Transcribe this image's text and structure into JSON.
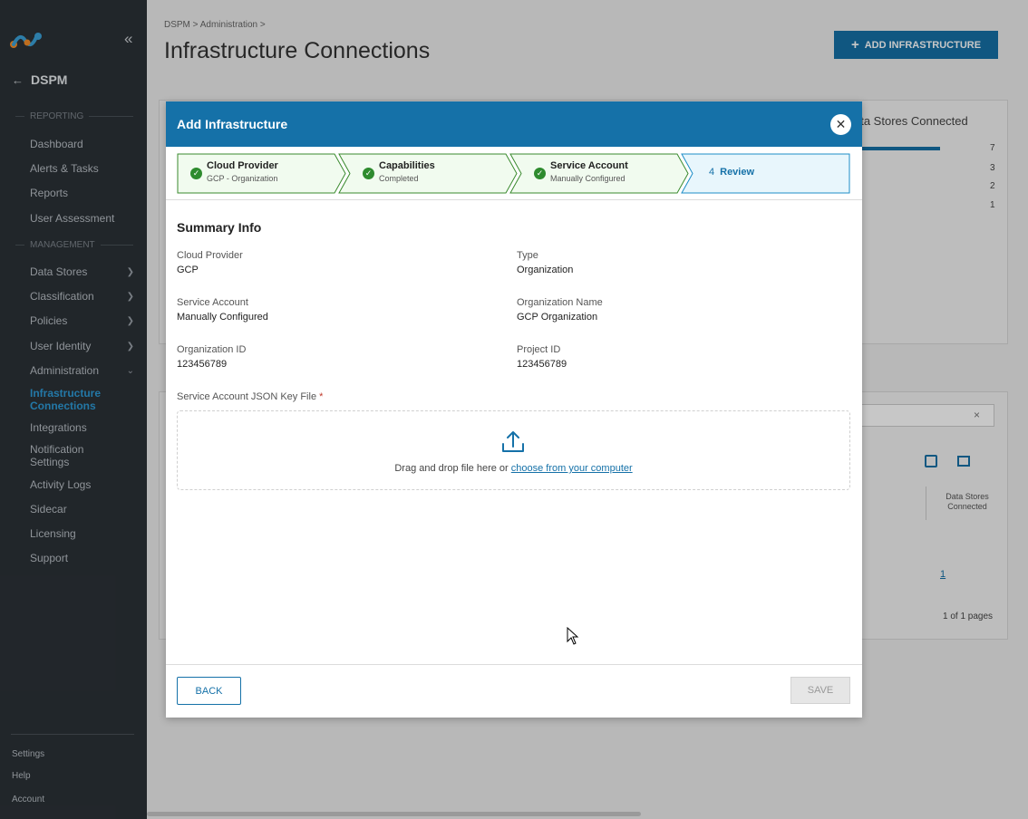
{
  "sidebar": {
    "app_name": "DSPM",
    "sections": {
      "reporting": "REPORTING",
      "management": "MANAGEMENT"
    },
    "reporting_items": [
      "Dashboard",
      "Alerts & Tasks",
      "Reports",
      "User Assessment"
    ],
    "management_items": [
      "Data Stores",
      "Classification",
      "Policies",
      "User Identity",
      "Administration"
    ],
    "admin_items": [
      "Infrastructure Connections",
      "Integrations",
      "Notification Settings",
      "Activity Logs",
      "Sidecar",
      "Licensing",
      "Support"
    ],
    "bottom_items": [
      "Settings",
      "Help",
      "Account"
    ],
    "colors": {
      "active": "#2d9ad6",
      "background": "#2b3137"
    }
  },
  "header": {
    "breadcrumb": "DSPM > Administration >",
    "title": "Infrastructure Connections",
    "add_button_label": "ADD INFRASTRUCTURE"
  },
  "background": {
    "card_title": "ata Stores Connected",
    "counts": [
      "7",
      "3",
      "2",
      "1"
    ],
    "table_header_partial": "d\ns",
    "table_header_col": "Data Stores Connected",
    "table_cell_link": "1",
    "pagination": "1 of 1 pages"
  },
  "modal": {
    "title": "Add Infrastructure",
    "steps": [
      {
        "title": "Cloud Provider",
        "subtitle": "GCP - Organization",
        "status": "done"
      },
      {
        "title": "Capabilities",
        "subtitle": "Completed",
        "status": "done"
      },
      {
        "title": "Service Account",
        "subtitle": "Manually Configured",
        "status": "done"
      },
      {
        "number": "4",
        "title": "Review",
        "status": "current"
      }
    ],
    "summary_title": "Summary Info",
    "fields": [
      {
        "label": "Cloud Provider",
        "value": "GCP"
      },
      {
        "label": "Type",
        "value": "Organization"
      },
      {
        "label": "Service Account",
        "value": "Manually Configured"
      },
      {
        "label": "Organization Name",
        "value": "GCP Organization"
      },
      {
        "label": "Organization ID",
        "value": "123456789"
      },
      {
        "label": "Project ID",
        "value": "123456789"
      }
    ],
    "upload": {
      "label": "Service Account JSON Key File",
      "required_mark": "*",
      "drop_text": "Drag and drop file here or ",
      "link_text": "choose from your computer"
    },
    "back_label": "BACK",
    "save_label": "SAVE",
    "colors": {
      "header": "#1571a8",
      "step_done_bg": "#f1fbef",
      "step_current_bg": "#e8f6fc"
    }
  }
}
